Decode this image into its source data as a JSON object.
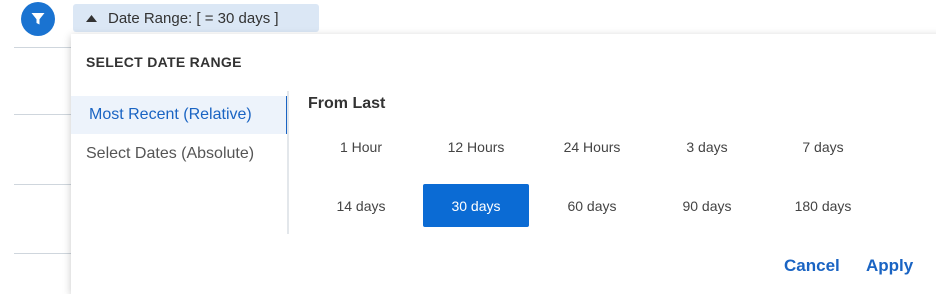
{
  "chip": {
    "label": "Date Range: [ = 30 days ]"
  },
  "popover": {
    "title": "SELECT DATE RANGE",
    "tabs": [
      {
        "label": "Most Recent (Relative)",
        "active": true
      },
      {
        "label": "Select Dates (Absolute)",
        "active": false
      }
    ],
    "section_title": "From Last",
    "options_row1": [
      "1 Hour",
      "12 Hours",
      "24 Hours",
      "3 days",
      "7 days"
    ],
    "options_row2": [
      "14 days",
      "30 days",
      "60 days",
      "90 days",
      "180 days"
    ],
    "selected_option": "30 days",
    "cancel_label": "Cancel",
    "apply_label": "Apply"
  },
  "colors": {
    "accent": "#1a64c3",
    "selected_bg": "#0b6bd4",
    "chip_bg": "#dbe7f5",
    "icon_bg": "#1a73d1"
  },
  "icons": {
    "filter": "filter-icon",
    "caret": "caret-up-icon"
  }
}
